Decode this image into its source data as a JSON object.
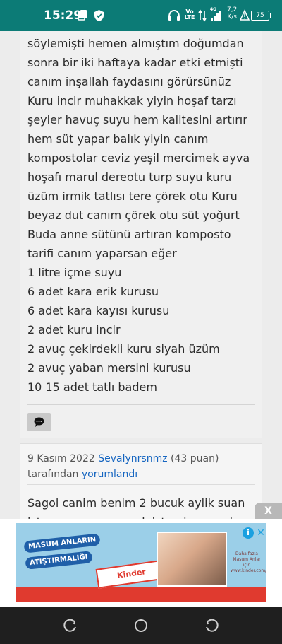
{
  "status_bar": {
    "time": "15:29",
    "net_speed_value": "7,2",
    "net_speed_unit": "K/s",
    "battery": "75",
    "volte": "Vo LTE",
    "signal_label": "4G"
  },
  "post": {
    "lines": [
      "söylemişti hemen almıştım doğumdan",
      "sonra bir iki haftaya kadar etki etmişti",
      "canım inşallah faydasını görürsünüz",
      "Kuru incir muhakkak yiyin hoşaf tarzı",
      "şeyler havuç suyu hem kalitesini artırır",
      "hem süt yapar balık yiyin canım",
      "kompostolar ceviz yeşil mercimek ayva",
      "hoşafı marul dereotu turp suyu kuru",
      "üzüm irmik tatlısı tere çörek otu Kuru",
      "beyaz dut canım çörek otu süt yoğurt",
      "Buda anne sütünü artıran komposto",
      "tarifi canım yaparsan eğer",
      "1 litre içme suyu",
      "6 adet kara erik kurusu",
      "6 adet kara kayısı kurusu",
      "2 adet kuru incir",
      "2 avuç çekirdekli kuru siyah üzüm",
      "2 avuç yaban mersini kurusu",
      "10 15 adet tatlı badem"
    ]
  },
  "comment": {
    "date": "9 Kasım 2022",
    "author": "Sevalynrsnmz",
    "points": "(43 puan)",
    "by_label": "tarafından",
    "action_label": "yorumlandı",
    "text_line1": "Sagol canim benim 2 bucuk aylik suan",
    "text_line2": "iste memeye yasmak istemiyor ve de"
  },
  "ad": {
    "close_label": "X",
    "badge_line1": "MASUM ANLARIN",
    "badge_line2": "ATIŞTIRMALIĞI",
    "product": "Kinder",
    "small_text": "Daha fazla Masum Anlar için www.kinder.com/tr",
    "info_label": "i",
    "x_label": "✕"
  },
  "colors": {
    "status_bar": "#0c7b76",
    "link": "#1565c0",
    "ad_red": "#e03a2f",
    "ad_blue": "#9bcfe8"
  },
  "icons": {
    "status_left": [
      "copy-icon",
      "shield-icon"
    ],
    "status_right": [
      "headset-icon",
      "volte-icon",
      "data-arrows-icon",
      "signal-icon",
      "warning-icon",
      "battery-icon"
    ],
    "nav": [
      "recents-icon",
      "home-icon",
      "back-icon"
    ],
    "comment": "comment-bubble-icon"
  }
}
